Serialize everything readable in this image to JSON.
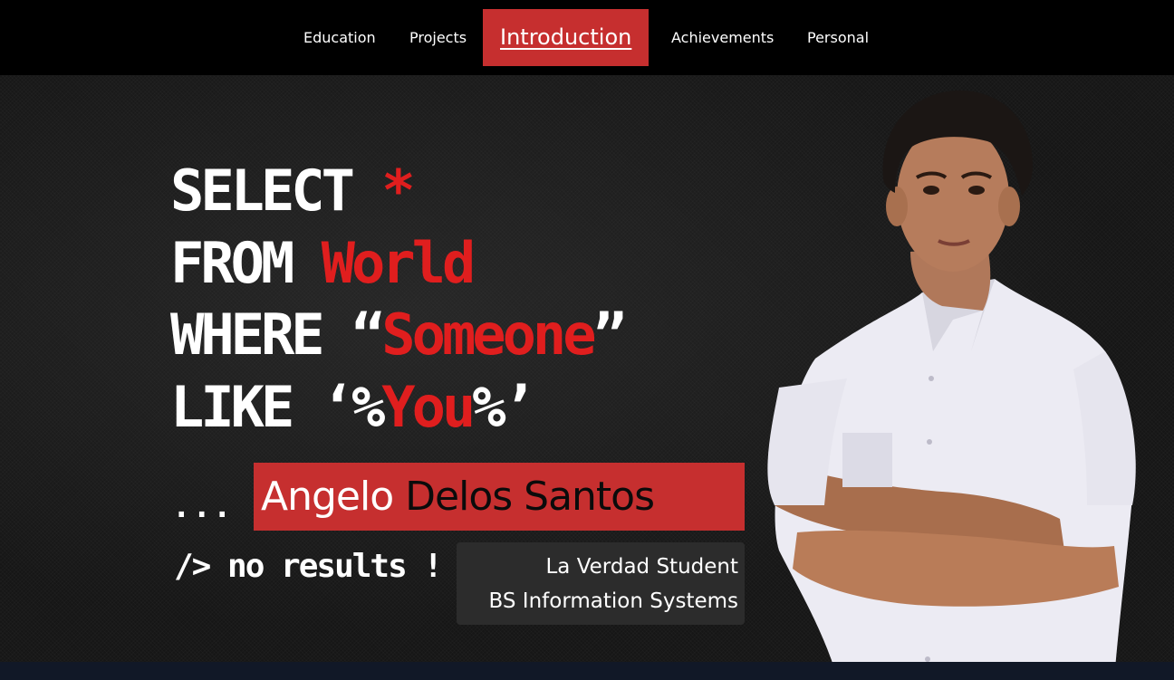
{
  "nav": {
    "items": [
      {
        "label": "Education"
      },
      {
        "label": "Projects"
      },
      {
        "label": "Introduction"
      },
      {
        "label": "Achievements"
      },
      {
        "label": "Personal"
      }
    ]
  },
  "hero": {
    "line1": {
      "keyword": "SELECT",
      "value": "*"
    },
    "line2": {
      "keyword": "FROM",
      "value": "World"
    },
    "line3": {
      "keyword": "WHERE",
      "open_quote": "“",
      "value": "Someone",
      "close_quote": "”"
    },
    "line4": {
      "keyword": "LIKE",
      "open": "‘%",
      "value": "You",
      "close": "%’"
    },
    "ellipsis": "...",
    "result": "/> no results !",
    "name_first": "Angelo",
    "name_last": "Delos Santos",
    "subtitle_line1": "La Verdad Student",
    "subtitle_line2": "BS Information Systems"
  },
  "colors": {
    "accent": "#c62f2f",
    "code_red": "#e01e1e",
    "background": "#161616"
  },
  "icons": {
    "portrait": "student-portrait"
  }
}
